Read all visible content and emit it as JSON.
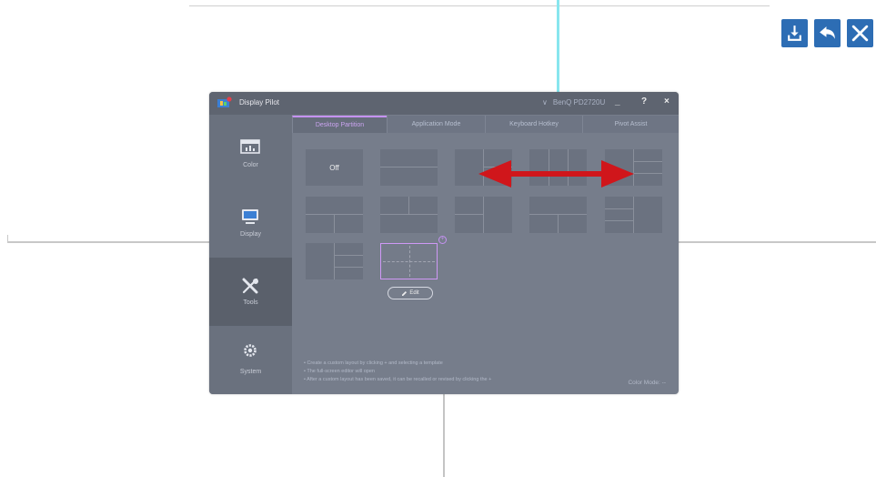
{
  "toolbar": {
    "download_icon": "download-icon",
    "back_icon": "reply-arrow-icon",
    "close_icon": "close-icon",
    "button_color": "#2d6db4"
  },
  "window": {
    "app_title": "Display Pilot",
    "monitor": "BenQ PD2720U",
    "controls": {
      "minimize": "_",
      "help": "?",
      "close": "×"
    }
  },
  "sidebar": {
    "items": [
      {
        "label": "Color",
        "icon": "color-monitor-icon"
      },
      {
        "label": "Display",
        "icon": "display-monitor-icon"
      },
      {
        "label": "Tools",
        "icon": "tools-icon",
        "active": true
      },
      {
        "label": "System",
        "icon": "gear-icon"
      }
    ]
  },
  "tabs": [
    {
      "label": "Desktop Partition",
      "active": true
    },
    {
      "label": "Application Mode"
    },
    {
      "label": "Keyboard Hotkey"
    },
    {
      "label": "Pivot Assist"
    }
  ],
  "partition": {
    "off_label": "Off",
    "edit_label": "Edit",
    "add_badge": "+"
  },
  "notes": [
    "•  Create a custom layout by clicking + and selecting a template",
    "•  The full-screen editor will open",
    "•  After a custom layout has been saved, it can be recalled or revised by clicking the +"
  ],
  "status": {
    "color_mode": "Color Mode: --"
  },
  "colors": {
    "accent": "#c592f2",
    "arrow": "#d0161b",
    "guide_cyan": "#88e6ee"
  }
}
